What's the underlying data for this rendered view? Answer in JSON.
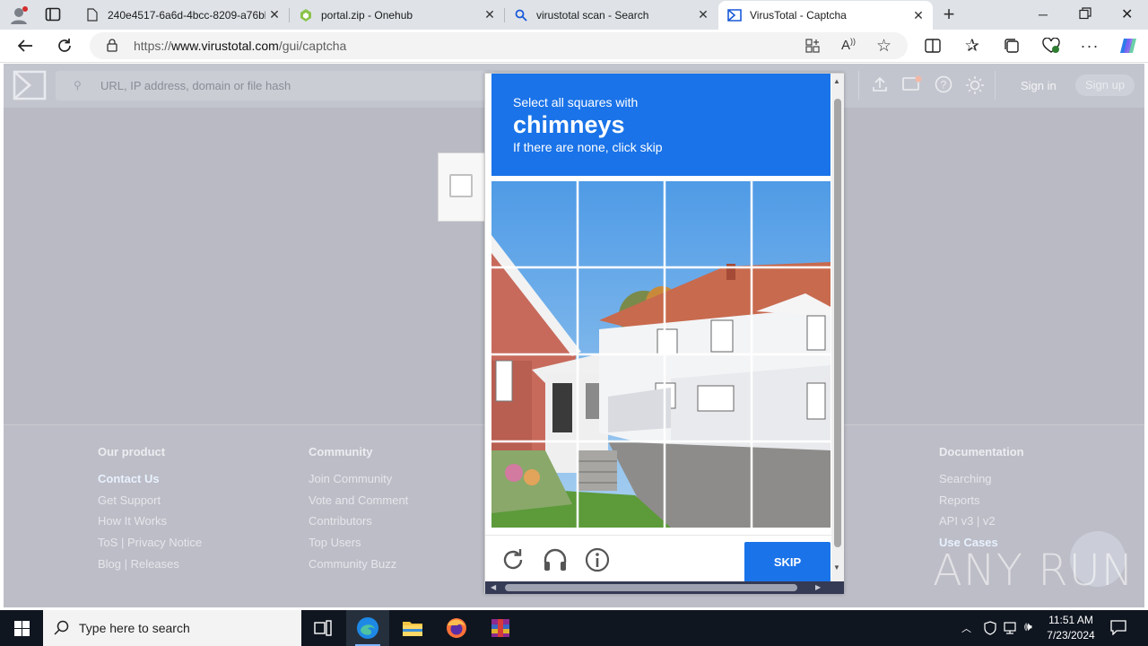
{
  "browser": {
    "tabs": [
      {
        "label": "240e4517-6a6d-4bcc-8209-a76bb",
        "icon": "file-icon",
        "active": false
      },
      {
        "label": "portal.zip - Onehub",
        "icon": "onehub-icon",
        "active": false
      },
      {
        "label": "virustotal scan - Search",
        "icon": "search-icon",
        "active": false
      },
      {
        "label": "VirusTotal - Captcha",
        "icon": "virustotal-icon",
        "active": true
      }
    ],
    "address": {
      "prefix": "https://",
      "domain": "www.virustotal.com",
      "path": "/gui/captcha"
    }
  },
  "vt": {
    "search_placeholder": "URL, IP address, domain or file hash",
    "sign_in": "Sign in",
    "sign_up": "Sign up"
  },
  "footer": {
    "columns": [
      {
        "heading": "Our product",
        "links": [
          "Contact Us",
          "Get Support",
          "How It Works",
          "ToS | Privacy Notice",
          "Blog | Releases"
        ]
      },
      {
        "heading": "Community",
        "links": [
          "Join Community",
          "Vote and Comment",
          "Contributors",
          "Top Users",
          "Community Buzz"
        ]
      },
      {
        "heading": "Documentation",
        "links": [
          "Searching",
          "Reports",
          "API v3 | v2",
          "Use Cases"
        ]
      }
    ]
  },
  "captcha": {
    "instruction": "Select all squares with",
    "target_word": "chimneys",
    "hint": "If there are none, click skip",
    "skip_label": "SKIP",
    "grid": "4x4",
    "accent_color": "#1a73e8"
  },
  "watermark": "ANY RUN",
  "taskbar": {
    "search_placeholder": "Type here to search",
    "time": "11:51 AM",
    "date": "7/23/2024"
  }
}
